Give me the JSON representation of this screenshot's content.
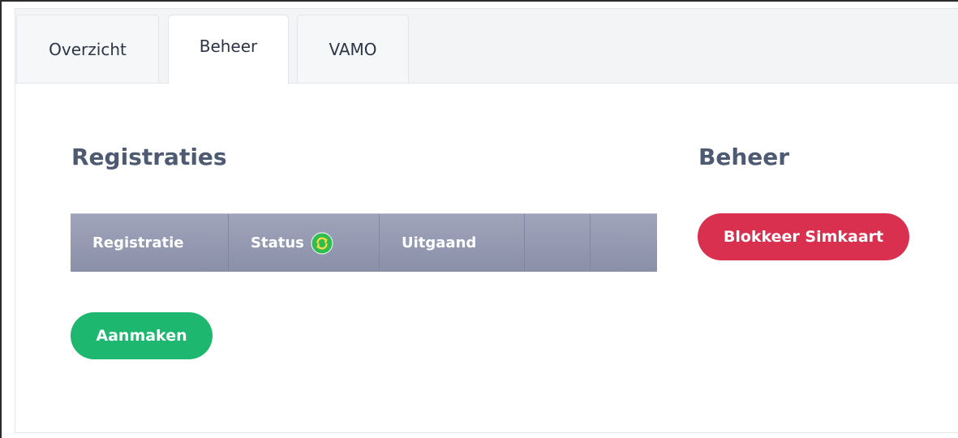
{
  "tabs": [
    {
      "label": "Overzicht"
    },
    {
      "label": "Beheer"
    },
    {
      "label": "VAMO"
    }
  ],
  "active_tab": "Beheer",
  "registraties": {
    "title": "Registraties",
    "columns": [
      "Registratie",
      "Status",
      "Uitgaand",
      "",
      ""
    ],
    "status_icon": "refresh-icon",
    "create_button": "Aanmaken"
  },
  "beheer": {
    "title": "Beheer",
    "block_button": "Blokkeer Simkaart"
  },
  "colors": {
    "create_button": "#1eb76f",
    "block_button": "#d9304f",
    "table_header": "#9196ad",
    "heading": "#4e5a72",
    "refresh_icon": "#2ebd4e"
  }
}
